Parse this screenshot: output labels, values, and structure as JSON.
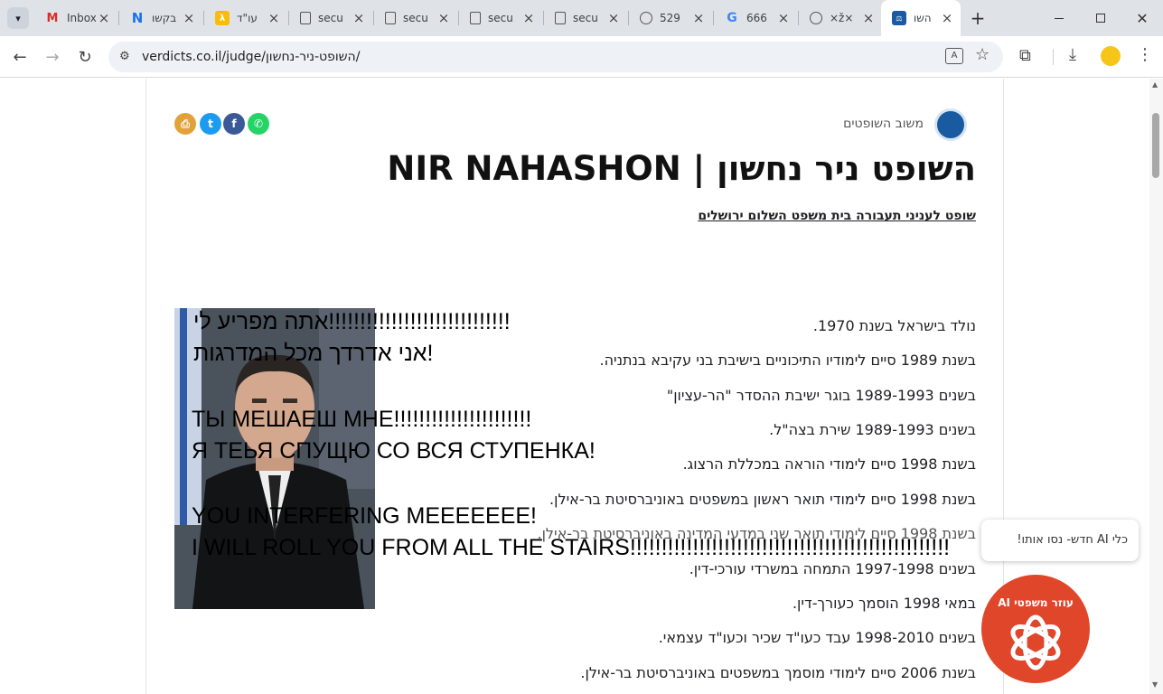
{
  "browser": {
    "tabs": [
      {
        "title": "Inbox",
        "favicon": "gmail-icon"
      },
      {
        "title": "בקשו",
        "favicon": "n-logo-icon"
      },
      {
        "title": "עו\"ד",
        "favicon": "law-icon"
      },
      {
        "title": "secu",
        "favicon": "doc-icon"
      },
      {
        "title": "secu",
        "favicon": "doc-icon"
      },
      {
        "title": "secu",
        "favicon": "doc-icon"
      },
      {
        "title": "secu",
        "favicon": "doc-icon"
      },
      {
        "title": "529",
        "favicon": "globe-icon"
      },
      {
        "title": "666",
        "favicon": "google-icon"
      },
      {
        "title": "×ž×",
        "favicon": "globe-icon"
      },
      {
        "title": "השו",
        "favicon": "verdicts-icon",
        "active": true
      }
    ],
    "url": "verdicts.co.il/judge/השופט-ניר-נחשון/"
  },
  "page": {
    "site_label": "משוב השופטים",
    "title": "השופט ניר נחשון | NIR NAHASHON",
    "subtitle": "שופט לעניני תעבורה בית משפט השלום ירושלים",
    "bio": [
      "נולד בישראל בשנת 1970.",
      "בשנת 1989 סיים לימודיו התיכוניים בישיבת בני עקיבא בנתניה.",
      "בשנים 1989-1993 בוגר ישיבת ההסדר \"הר-עציון\"",
      "בשנים 1989-1993 שירת בצה\"ל.",
      "בשנת 1998 סיים לימודי הוראה במכללת הרצוג.",
      "בשנת 1998 סיים לימודי תואר ראשון במשפטים באוניברסיטת בר-אילן.",
      "בשנת 1998 סיים לימודי תואר שני במדעי המדינה באוניברסיטת בר-אילן.",
      "בשנים 1997-1998 התמחה במשרדי עורכי-דין.",
      "במאי 1998 הוסמך כעורך-דין.",
      "בשנים 1998-2010 עבד כעו\"ד שכיר וכעו\"ד עצמאי.",
      "בשנת 2006 סיים לימודי מוסמך במשפטים באוניברסיטת בר-אילן."
    ],
    "overlay": [
      "!!!!!!!!!!!!!!!!!!!!!!!!!!!!!אתה מפריע לי",
      "!אני אדרדך מכל המדרגות",
      "ТЫ МЕШАЕШ МНЕ!!!!!!!!!!!!!!!!!!!!!!",
      "Я ТЕЬЯ СПУЩЮ СО ВСЯ СТУПЕНКА!",
      "YOU INTERFERING MEEEEEEE!",
      "I WILL ROLL YOU FROM ALL THE STAIRS!!!!!!!!!!!!!!!!!!!!!!!!!!!!!!!!!!!!!!!!!!!!!!!!!!!"
    ],
    "chat_bubble": "כלי AI חדש- נסו אותו!",
    "ai_button": "עוזר משפטי AI"
  }
}
